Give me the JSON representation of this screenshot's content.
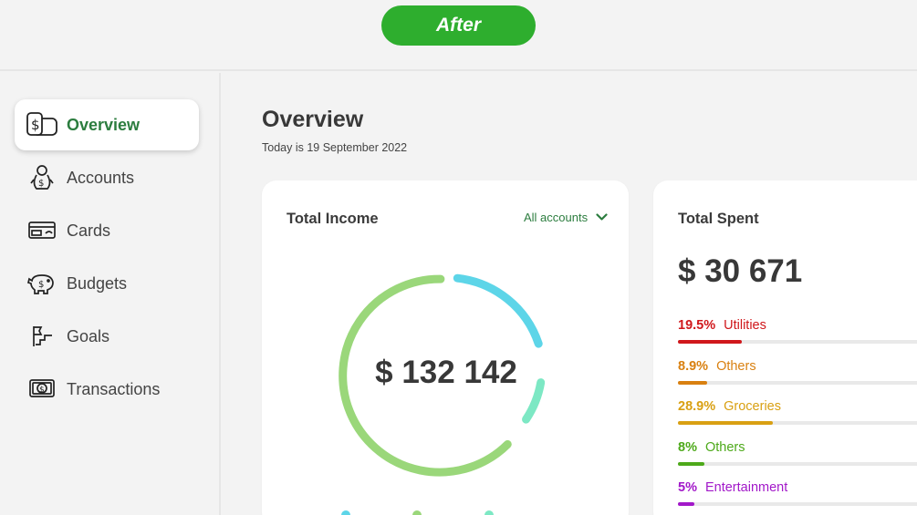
{
  "banner": {
    "label": "After",
    "color": "#2eae2e"
  },
  "sidebar": {
    "items": [
      {
        "label": "Overview",
        "icon": "wallet-dollar-icon",
        "active": true
      },
      {
        "label": "Accounts",
        "icon": "bank-account-icon",
        "active": false
      },
      {
        "label": "Cards",
        "icon": "credit-card-icon",
        "active": false
      },
      {
        "label": "Budgets",
        "icon": "piggy-bank-icon",
        "active": false
      },
      {
        "label": "Goals",
        "icon": "goal-flag-icon",
        "active": false
      },
      {
        "label": "Transactions",
        "icon": "money-transfer-icon",
        "active": false
      }
    ]
  },
  "main": {
    "title": "Overview",
    "date": "Today is 19 September 2022"
  },
  "income": {
    "title": "Total Income",
    "account_filter": "All accounts",
    "amount": "$ 132 142",
    "segments": [
      {
        "color": "#5dd5e8"
      },
      {
        "color": "#7de8c4"
      },
      {
        "color": "#9ad77a"
      }
    ]
  },
  "spent": {
    "title": "Total Spent",
    "amount": "$ 30 671",
    "categories": [
      {
        "percent": "19.5%",
        "label": "Utilities",
        "value": 19.5,
        "color": "#d0171b"
      },
      {
        "percent": "8.9%",
        "label": "Others",
        "value": 8.9,
        "color": "#d98010"
      },
      {
        "percent": "28.9%",
        "label": "Groceries",
        "value": 28.9,
        "color": "#d9a012"
      },
      {
        "percent": "8%",
        "label": "Others",
        "value": 8,
        "color": "#4da91a"
      },
      {
        "percent": "5%",
        "label": "Entertainment",
        "value": 5,
        "color": "#a218c9"
      }
    ]
  },
  "colors": {
    "accent": "#2c7d3f",
    "background": "#f3f3f3",
    "card": "#ffffff"
  }
}
